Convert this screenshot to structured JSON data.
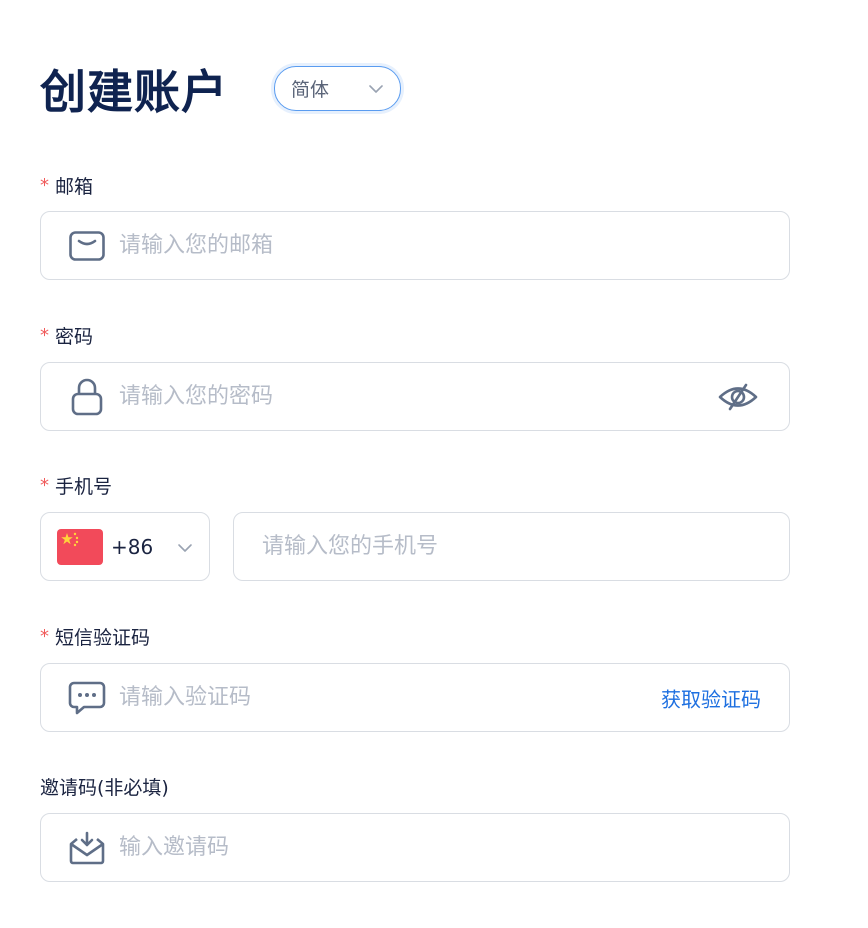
{
  "header": {
    "title": "创建账户",
    "language": "简体"
  },
  "email": {
    "required_mark": "*",
    "label": "邮箱",
    "placeholder": "请输入您的邮箱",
    "icon": "mail-icon"
  },
  "password": {
    "required_mark": "*",
    "label": "密码",
    "placeholder": "请输入您的密码",
    "icon": "lock-icon",
    "toggle_icon": "eye-off-icon"
  },
  "phone": {
    "required_mark": "*",
    "label": "手机号",
    "country_code": "+86",
    "flag": "china-flag-icon",
    "placeholder": "请输入您的手机号"
  },
  "sms": {
    "required_mark": "*",
    "label": "短信验证码",
    "placeholder": "请输入验证码",
    "icon": "chat-bubble-icon",
    "get_code_label": "获取验证码"
  },
  "invite": {
    "label": "邀请码(非必填)",
    "placeholder": "输入邀请码",
    "icon": "inbox-download-icon"
  },
  "colors": {
    "title": "#0f2350",
    "required": "#f05a5a",
    "link": "#1d6fe0",
    "border": "#d9dde3",
    "placeholder": "#b6bcc8",
    "focus": "#5a9cf0"
  }
}
